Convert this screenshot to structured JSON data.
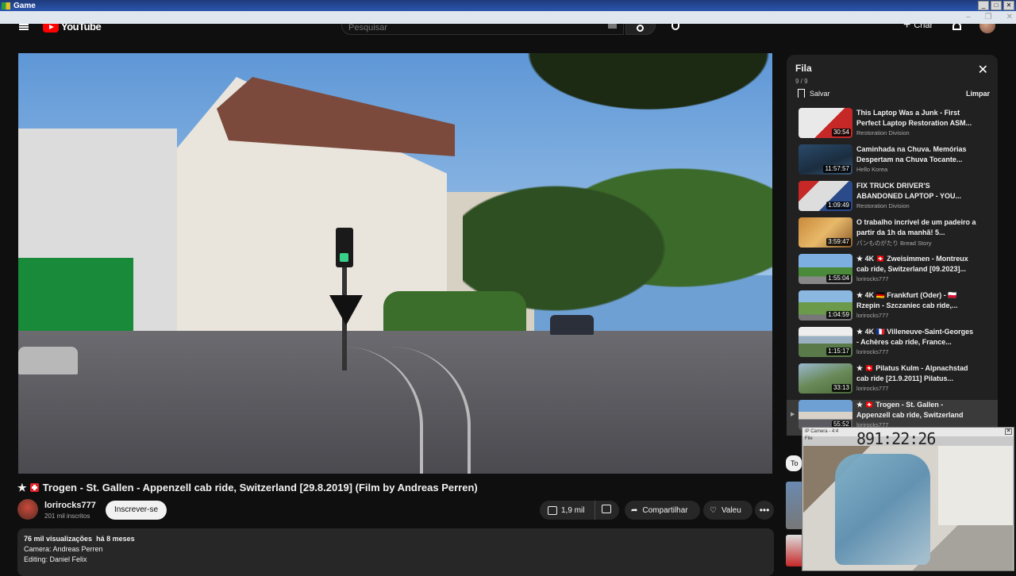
{
  "os": {
    "title": "Game"
  },
  "header": {
    "logo": "YouTube",
    "search_placeholder": "Pesquisar",
    "create_label": "Criar"
  },
  "video": {
    "title_prefix": "★",
    "title": "Trogen - St. Gallen - Appenzell cab ride, Switzerland [29.8.2019] (Film by Andreas Perren)",
    "channel": "lorirocks777",
    "subscribers": "201 mil inscritos",
    "subscribe_label": "Inscrever-se",
    "likes": "1,9 mil",
    "share_label": "Compartilhar",
    "thanks_label": "Valeu",
    "more_label": "•••",
    "views": "76 mil visualizações",
    "age": "há 8 meses",
    "desc_line1": "Camera: Andreas Perren",
    "desc_line2": "Editing: Daniel Felix"
  },
  "queue": {
    "title": "Fila",
    "count": "9 / 9",
    "save_label": "Salvar",
    "clear_label": "Limpar",
    "items": [
      {
        "title": "This Laptop Was a Junk - First Perfect Laptop Restoration ASM...",
        "channel": "Restoration Division",
        "duration": "30:54",
        "thumb": "linear-gradient(135deg,#e9e9e9 0 55%,#c62828 55%)"
      },
      {
        "title": "Caminhada na Chuva. Memórias Despertam na Chuva Tocante...",
        "channel": "Hello Korea",
        "duration": "11:57:57",
        "thumb": "linear-gradient(160deg,#2a4a6a,#1b2d3f 60%,#3a5a7a)"
      },
      {
        "title": "FIX TRUCK DRIVER'S ABANDONED LAPTOP - YOU...",
        "channel": "Restoration Division",
        "duration": "1:09:49",
        "thumb": "linear-gradient(135deg,#c62828 0 25%,#ddd 25% 60%,#2a4a8a 60%)"
      },
      {
        "title": "O trabalho incrível de um padeiro a partir da 1h da manhã! 5...",
        "channel": "パンものがたり Bread Story",
        "duration": "3:59:47",
        "thumb": "linear-gradient(135deg,#c9893a,#e8b96a 50%,#8a5a2a)"
      },
      {
        "title": "★ 4K 🇨🇭 Zweisimmen - Montreux cab ride, Switzerland [09.2023]...",
        "channel": "lorirocks777",
        "duration": "1:55:04",
        "thumb": "linear-gradient(#7db0e0 0 45%,#4a8a3a 45% 75%,#888 75%)"
      },
      {
        "title": "★ 4K 🇩🇪 Frankfurt (Oder) - 🇵🇱 Rzepin - Szczaniec cab ride,...",
        "channel": "lorirocks777",
        "duration": "1:04:59",
        "thumb": "linear-gradient(#8ab8e0 0 40%,#6a9a4a 40% 80%,#777 80%)"
      },
      {
        "title": "★ 4K 🇫🇷 Villeneuve-Saint-Georges - Achères cab ride, France...",
        "channel": "lorirocks777",
        "duration": "1:15:17",
        "thumb": "linear-gradient(#eee 0 30%,#9ab0c0 30% 55%,#5a7a4a 55%)"
      },
      {
        "title": "★ 🇨🇭 Pilatus Kulm - Alpnachstad cab ride [21.9.2011] Pilatus...",
        "channel": "lorirocks777",
        "duration": "33:13",
        "thumb": "linear-gradient(160deg,#9ab8d0,#6a8a5a 50%,#4a6a3a)"
      },
      {
        "title": "★ 🇨🇭 Trogen - St. Gallen - Appenzell cab ride, Switzerland [29.8.2019] (Film by...",
        "channel": "lorirocks777",
        "duration": "55:52",
        "thumb": "linear-gradient(#6fa0d4 0 40%,#d8d2c8 40% 65%,#5a5a60 65%)",
        "active": true
      }
    ]
  },
  "side": {
    "chip": "To"
  },
  "webcam": {
    "titlebar": "IP Camera - 4:4",
    "menu": "File",
    "timer": "891:22:26"
  },
  "colors": {
    "accent": "#ff0000",
    "bg": "#0f0f0f",
    "panel": "#212121"
  }
}
